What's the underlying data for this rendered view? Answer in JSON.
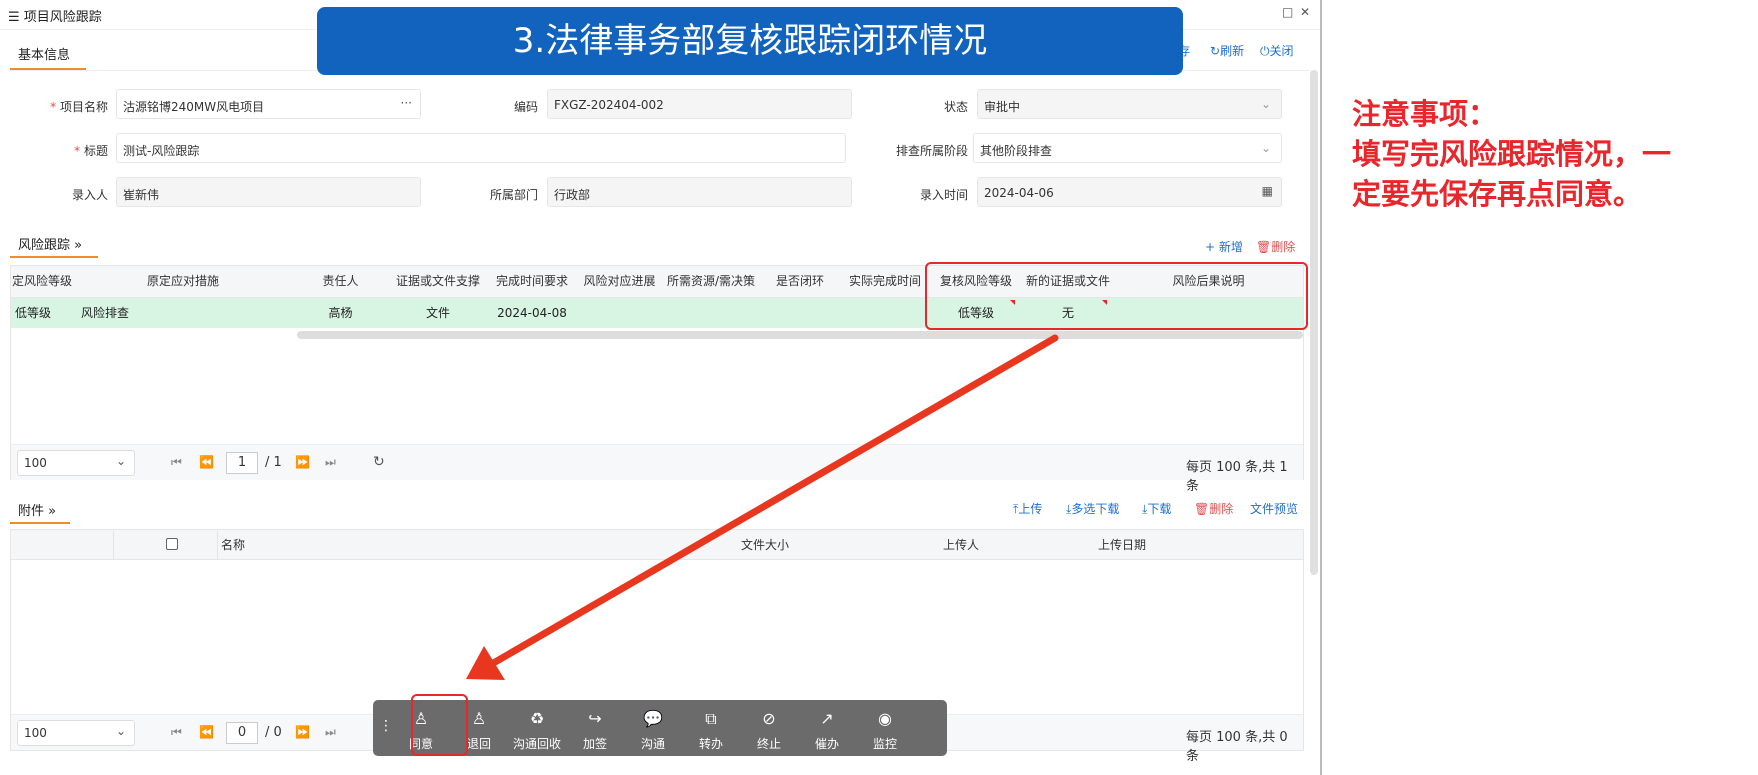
{
  "window": {
    "title": "项目风险跟踪",
    "maximize_icon": "maximize-icon",
    "close_icon": "close-icon"
  },
  "banner": {
    "text": "3.法律事务部复核跟踪闭环情况"
  },
  "header_actions": {
    "save": "存",
    "refresh": "刷新",
    "close": "关闭"
  },
  "basic_info": {
    "tab": "基本信息",
    "project_name_label": "项目名称",
    "project_name": "沽源铭博240MW风电项目",
    "more": "···",
    "code_label": "编码",
    "code": "FXGZ-202404-002",
    "status_label": "状态",
    "status": "审批中",
    "title_label": "标题",
    "title": "测试-风险跟踪",
    "stage_label": "排查所属阶段",
    "stage": "其他阶段排查",
    "entry_person_label": "录入人",
    "entry_person": "崔新伟",
    "dept_label": "所属部门",
    "dept": "行政部",
    "entry_time_label": "录入时间",
    "entry_time": "2024-04-06"
  },
  "risk_tracking": {
    "tab": "风险跟踪",
    "add": "新增",
    "delete": "删除",
    "columns": [
      "定风险等级",
      "原定应对措施",
      "责任人",
      "证据或文件支撑",
      "完成时间要求",
      "风险对应进展",
      "所需资源/需决策",
      "是否闭环",
      "实际完成时间",
      "复核风险等级",
      "新的证据或文件",
      "风险后果说明"
    ],
    "rows": [
      {
        "level": "低等级",
        "measure": "风险排查",
        "owner": "高杨",
        "evidence": "文件",
        "due": "2024-04-08",
        "progress": "",
        "resources": "",
        "closed": "",
        "actual": "",
        "review_level": "低等级",
        "new_evidence": "无",
        "consequence": ""
      }
    ],
    "pager": {
      "page_size": "100",
      "page": "1",
      "total_pages": "/ 1",
      "summary": "每页 100 条,共 1 条"
    }
  },
  "attachments": {
    "tab": "附件",
    "upload": "上传",
    "multi_download": "多选下载",
    "download": "下载",
    "delete": "删除",
    "preview": "文件预览",
    "columns": [
      "名称",
      "文件大小",
      "上传人",
      "上传日期"
    ],
    "pager": {
      "page_size": "100",
      "page": "0",
      "total_pages": "/ 0",
      "summary": "每页 100 条,共 0 条"
    }
  },
  "toolbar": {
    "items": [
      "同意",
      "退回",
      "沟通回收",
      "加签",
      "沟通",
      "转办",
      "终止",
      "催办",
      "监控"
    ]
  },
  "note": {
    "line1": "注意事项：",
    "line2": "填写完风险跟踪情况，一",
    "line3": "定要先保存再点同意。"
  },
  "colors": {
    "accent": "#f08c2e",
    "link": "#1e6fd0",
    "highlight": "#e8262b",
    "row_selected": "#d8f5e3",
    "banner": "#1263bd"
  }
}
